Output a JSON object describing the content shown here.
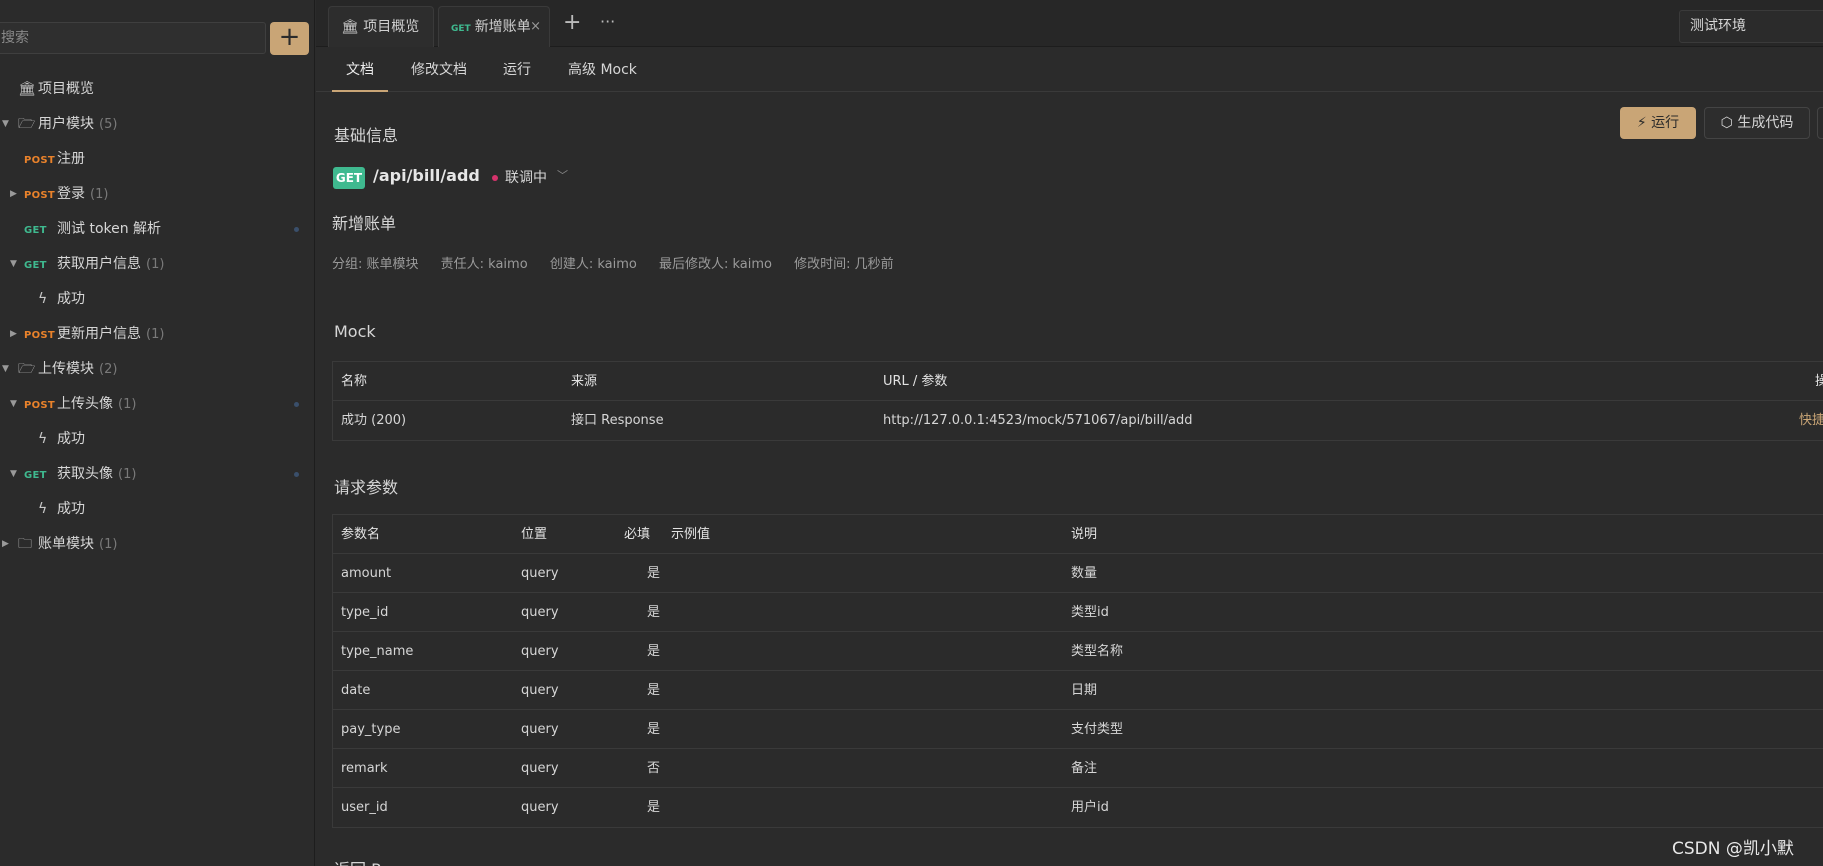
{
  "sidebar": {
    "search_placeholder": "搜索",
    "add_label": "+",
    "tree": [
      {
        "type": "overview",
        "label": "项目概览"
      },
      {
        "type": "folder",
        "label": "用户模块",
        "count": "(5)",
        "open": true
      },
      {
        "type": "api",
        "method": "POST",
        "label": "注册"
      },
      {
        "type": "api",
        "method": "POST",
        "label": "登录",
        "count": "(1)",
        "caret": true
      },
      {
        "type": "api",
        "method": "GET",
        "label": "测试 token 解析",
        "dot": true
      },
      {
        "type": "api",
        "method": "GET",
        "label": "获取用户信息",
        "count": "(1)",
        "caret": true,
        "open": true
      },
      {
        "type": "mock",
        "label": "成功"
      },
      {
        "type": "api",
        "method": "POST",
        "label": "更新用户信息",
        "count": "(1)",
        "caret": true
      },
      {
        "type": "folder",
        "label": "上传模块",
        "count": "(2)",
        "open": true
      },
      {
        "type": "api",
        "method": "POST",
        "label": "上传头像",
        "count": "(1)",
        "caret": true,
        "open": true,
        "dot": true
      },
      {
        "type": "mock",
        "label": "成功"
      },
      {
        "type": "api",
        "method": "GET",
        "label": "获取头像",
        "count": "(1)",
        "caret": true,
        "open": true,
        "dot": true
      },
      {
        "type": "mock",
        "label": "成功"
      },
      {
        "type": "folder",
        "label": "账单模块",
        "count": "(1)",
        "open": false
      }
    ]
  },
  "tabs": {
    "overview": "项目概览",
    "active_method": "GET",
    "active_label": "新增账单",
    "close": "×",
    "plus": "+",
    "more": "···",
    "environment": "测试环境"
  },
  "subtabs": [
    "文档",
    "修改文档",
    "运行",
    "高级 Mock"
  ],
  "basic": {
    "title": "基础信息",
    "run_label": "运行",
    "gen_label": "生成代码",
    "method": "GET",
    "path": "/api/bill/add",
    "status": "联调中",
    "name": "新增账单",
    "meta": [
      "分组: 账单模块",
      "责任人: kaimo",
      "创建人: kaimo",
      "最后修改人: kaimo",
      "修改时间: 几秒前"
    ]
  },
  "mock": {
    "title": "Mock",
    "headers": [
      "名称",
      "来源",
      "URL / 参数",
      "操"
    ],
    "rows": [
      {
        "name": "成功 (200)",
        "source": "接口 Response",
        "url": "http://127.0.0.1:4523/mock/571067/api/bill/add",
        "action": "快捷"
      }
    ]
  },
  "params": {
    "title": "请求参数",
    "headers": [
      "参数名",
      "位置",
      "必填",
      "示例值",
      "说明"
    ],
    "rows": [
      {
        "name": "amount",
        "pos": "query",
        "req": "是",
        "example": "",
        "desc": "数量"
      },
      {
        "name": "type_id",
        "pos": "query",
        "req": "是",
        "example": "",
        "desc": "类型id"
      },
      {
        "name": "type_name",
        "pos": "query",
        "req": "是",
        "example": "",
        "desc": "类型名称"
      },
      {
        "name": "date",
        "pos": "query",
        "req": "是",
        "example": "",
        "desc": "日期"
      },
      {
        "name": "pay_type",
        "pos": "query",
        "req": "是",
        "example": "",
        "desc": "支付类型"
      },
      {
        "name": "remark",
        "pos": "query",
        "req": "否",
        "example": "",
        "desc": "备注"
      },
      {
        "name": "user_id",
        "pos": "query",
        "req": "是",
        "example": "",
        "desc": "用户id"
      }
    ]
  },
  "next_section_title": "返回 Response",
  "watermark": "CSDN @凯小默",
  "colors": {
    "accent": "#c9a576",
    "get": "#3fb98f",
    "post": "#e9822b",
    "status": "#d6336c"
  }
}
